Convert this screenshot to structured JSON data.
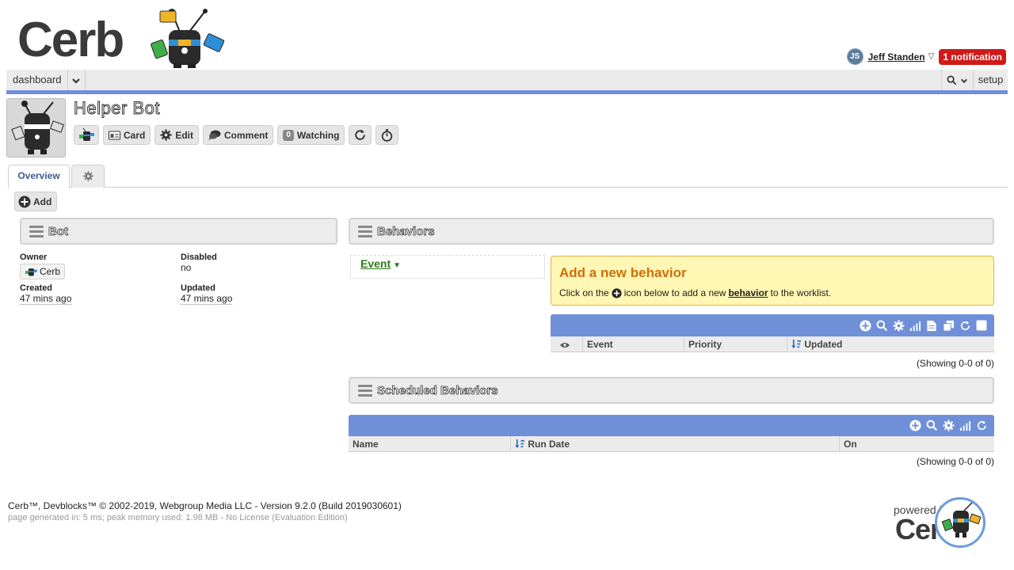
{
  "app": {
    "logo_text": "Cerb"
  },
  "user": {
    "initials": "JS",
    "name": "Jeff Standen",
    "notifications": "1 notification"
  },
  "menu": {
    "dashboard": "dashboard",
    "setup": "setup"
  },
  "profile": {
    "title": "Helper Bot",
    "toolbar": {
      "card": "Card",
      "edit": "Edit",
      "comment": "Comment",
      "watch_count": "0",
      "watching": "Watching"
    }
  },
  "tabs": {
    "overview": "Overview"
  },
  "add_label": "Add",
  "bot_widget": {
    "title": "Bot",
    "owner_label": "Owner",
    "owner_value": "Cerb",
    "disabled_label": "Disabled",
    "disabled_value": "no",
    "created_label": "Created",
    "created_value": "47 mins ago",
    "updated_label": "Updated",
    "updated_value": "47 mins ago"
  },
  "behaviors_widget": {
    "title": "Behaviors",
    "filter_label": "Event",
    "help_title": "Add a new behavior",
    "help_before": "Click on the",
    "help_mid": "icon below to add a new",
    "help_link": "behavior",
    "help_after": "to the worklist.",
    "columns": [
      "Event",
      "Priority",
      "Updated"
    ],
    "showing": "(Showing 0-0 of 0)"
  },
  "scheduled_widget": {
    "title": "Scheduled Behaviors",
    "columns": [
      "Name",
      "Run Date",
      "On"
    ],
    "showing": "(Showing 0-0 of 0)"
  },
  "footer": {
    "line1": "Cerb™, Devblocks™ © 2002-2019, Webgroup Media LLC - Version 9.2.0 (Build 2019030601)",
    "line2": "page generated in: 5 ms; peak memory used: 1.98 MB - No License (Evaluation Edition)",
    "powered": "powered by",
    "powered_logo": "Cerb"
  },
  "colors": {
    "accent": "#7091d9",
    "notification": "#d01a1a",
    "event_link": "#2d7a18",
    "help_title": "#cf6d0e",
    "help_bg": "#fff7b3"
  },
  "icons": [
    "bot-logo-icon",
    "chevron-down-icon",
    "search-icon",
    "card-icon",
    "gear-icon",
    "comment-icon",
    "refresh-icon",
    "stopwatch-icon",
    "plus-circle-icon",
    "eye-icon",
    "sort-desc-icon",
    "fit-icon",
    "export-icon",
    "copy-icon",
    "checkbox-icon"
  ]
}
